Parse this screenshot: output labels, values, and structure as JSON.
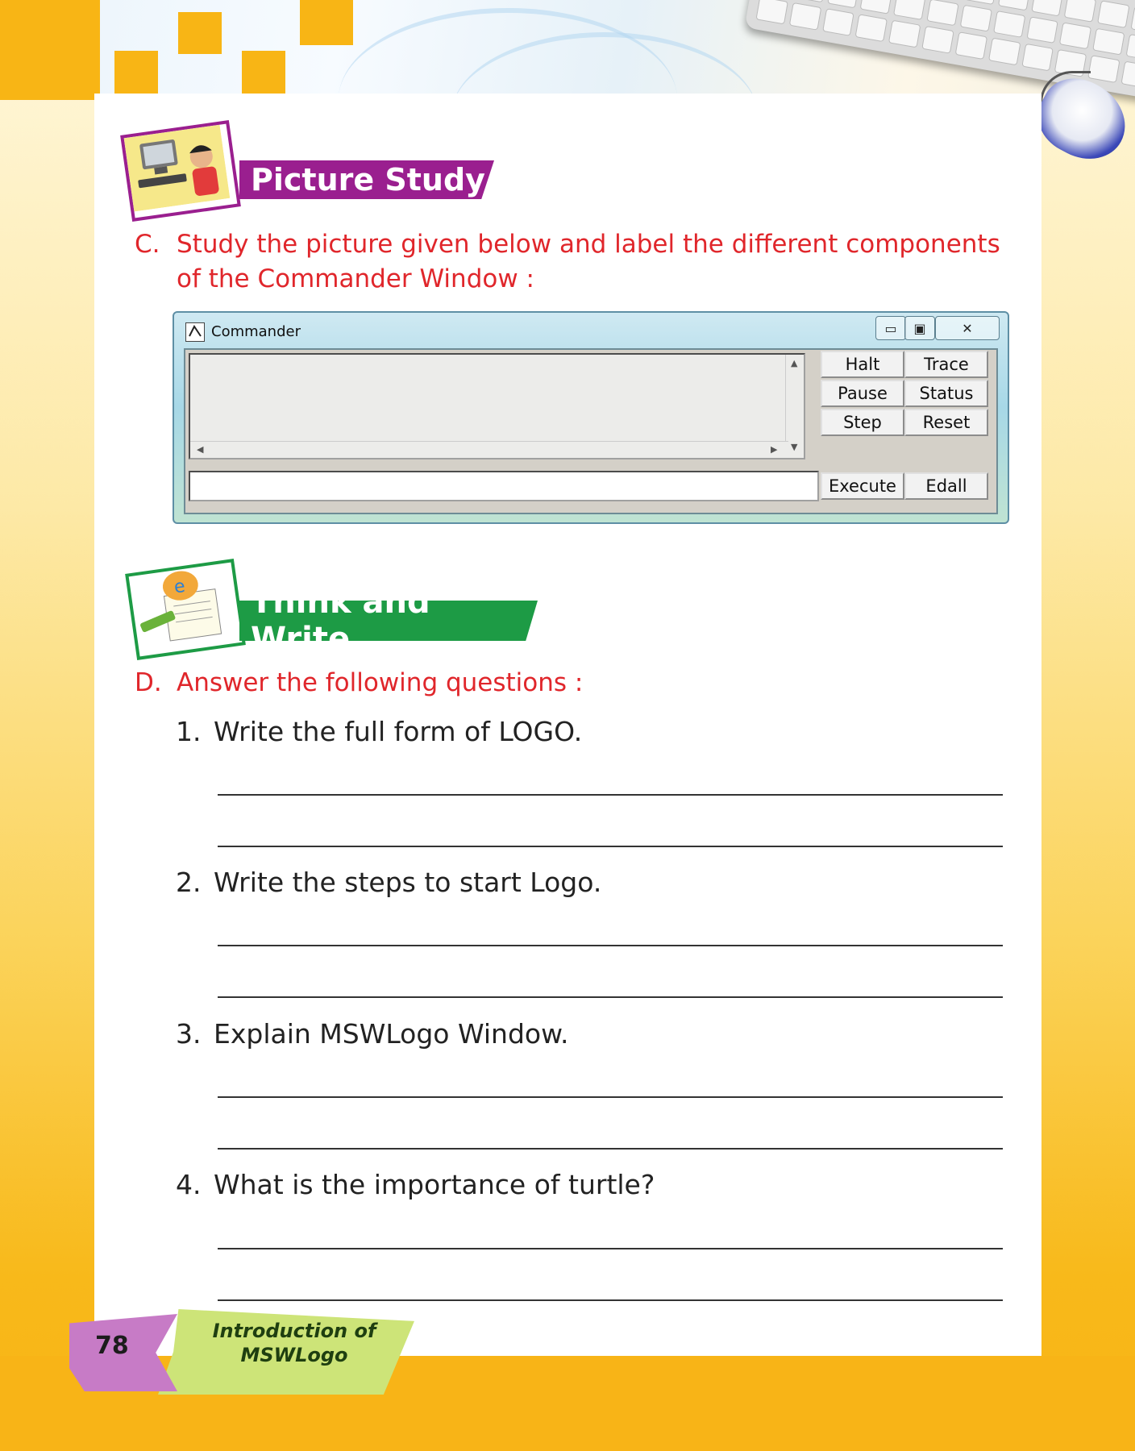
{
  "page": {
    "number": "78",
    "chapter_title_line1": "Introduction of",
    "chapter_title_line2": "MSWLogo"
  },
  "section_c": {
    "heading": "Picture  Study",
    "label": "C.",
    "instruction_line1": "Study the picture given below and label the different components",
    "instruction_line2": "of the Commander Window :"
  },
  "commander": {
    "title": "Commander",
    "app_icon": "logo-app-icon",
    "controls": [
      "minimize-icon",
      "maximize-icon",
      "close-icon"
    ],
    "buttons": [
      "Halt",
      "Trace",
      "Pause",
      "Status",
      "Step",
      "Reset",
      "Execute",
      "Edall"
    ]
  },
  "section_d": {
    "heading": "Think and Write",
    "label": "D.",
    "instruction": "Answer the following questions :",
    "questions": [
      {
        "num": "1.",
        "text": "Write the full form of LOGO."
      },
      {
        "num": "2.",
        "text": "Write the steps to start Logo."
      },
      {
        "num": "3.",
        "text": "Explain MSWLogo Window."
      },
      {
        "num": "4.",
        "text": "What is the importance of turtle?"
      }
    ]
  },
  "colors": {
    "accent_orange": "#f8b515",
    "heading_purple": "#9a1f8f",
    "heading_green": "#1d9b45",
    "question_red": "#e0262b"
  }
}
